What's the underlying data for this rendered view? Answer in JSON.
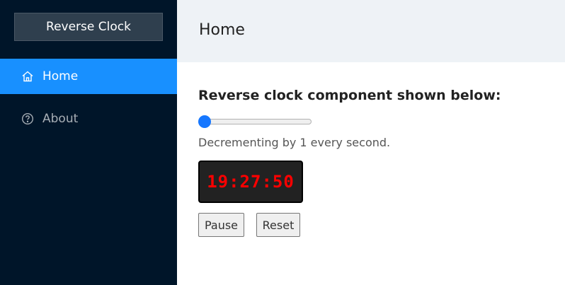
{
  "sidebar": {
    "logo": "Reverse Clock",
    "items": [
      {
        "label": "Home",
        "icon": "home-icon",
        "active": true
      },
      {
        "label": "About",
        "icon": "question-circle-icon",
        "active": false
      }
    ]
  },
  "header": {
    "title": "Home"
  },
  "main": {
    "heading": "Reverse clock component shown below:",
    "slider": {
      "value": 0
    },
    "description": "Decrementing by 1 every second.",
    "clock": "19:27:50",
    "buttons": {
      "pause": "Pause",
      "reset": "Reset"
    }
  },
  "colors": {
    "sidebar_bg": "#001529",
    "active_item": "#1890ff",
    "header_bg": "#eef2f6",
    "clock_text": "#ff0000",
    "slider_thumb": "#1677ff"
  }
}
